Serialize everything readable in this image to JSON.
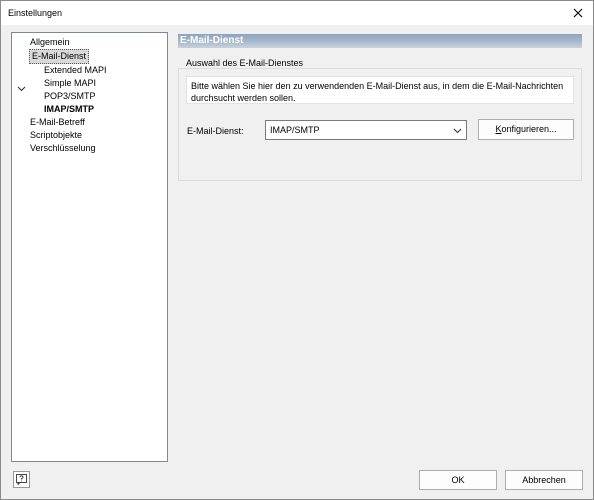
{
  "window": {
    "title": "Einstellungen"
  },
  "tree": {
    "items": [
      {
        "label": "Allgemein"
      },
      {
        "label": "E-Mail-Dienst"
      },
      {
        "label": "Extended MAPI"
      },
      {
        "label": "Simple MAPI"
      },
      {
        "label": "POP3/SMTP"
      },
      {
        "label": "IMAP/SMTP"
      },
      {
        "label": "E-Mail-Betreff"
      },
      {
        "label": "Scriptobjekte"
      },
      {
        "label": "Verschlüsselung"
      }
    ]
  },
  "panel": {
    "header": "E-Mail-Dienst",
    "group_title": "Auswahl des E-Mail-Dienstes",
    "description_line1": "Bitte wählen Sie hier den zu verwendenden E-Mail-Dienst aus, in dem die E-Mail-Nachrichten",
    "description_line2": "durchsucht werden sollen.",
    "service_label": "E-Mail-Dienst:",
    "service_value": "IMAP/SMTP",
    "configure_prefix": "K",
    "configure_rest": "onfigurieren..."
  },
  "footer": {
    "ok_label": "OK",
    "cancel_label": "Abbrechen"
  },
  "icons": {
    "close": "close-icon",
    "expander": "chevron-down-icon",
    "dropdown": "chevron-down-icon",
    "help": "help-icon"
  }
}
